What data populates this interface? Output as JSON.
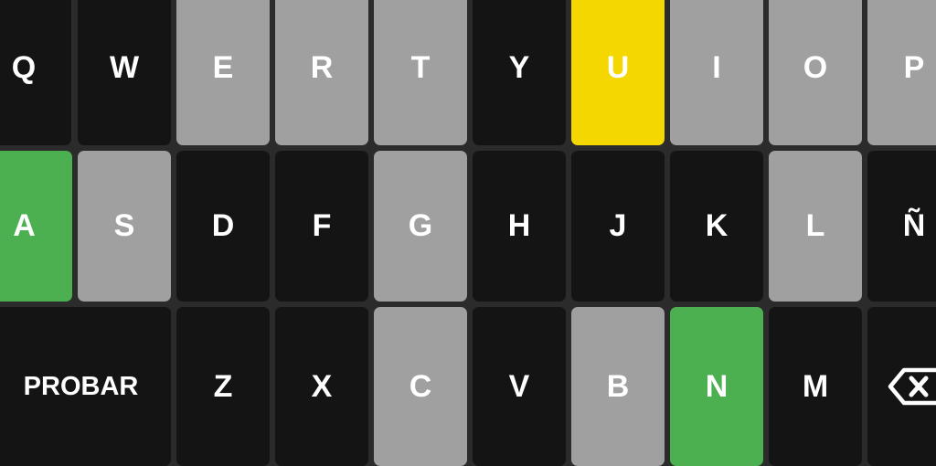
{
  "colors": {
    "background": "#2b2b2b",
    "absent": "#141414",
    "present_elsewhere": "#a0a0a0",
    "present": "#f5d700",
    "correct": "#4caf50",
    "text": "#ffffff"
  },
  "keyboard": {
    "row1": [
      {
        "label": "Q",
        "state": "absent"
      },
      {
        "label": "W",
        "state": "absent"
      },
      {
        "label": "E",
        "state": "gray"
      },
      {
        "label": "R",
        "state": "gray"
      },
      {
        "label": "T",
        "state": "gray"
      },
      {
        "label": "Y",
        "state": "absent"
      },
      {
        "label": "U",
        "state": "present"
      },
      {
        "label": "I",
        "state": "gray"
      },
      {
        "label": "O",
        "state": "gray"
      },
      {
        "label": "P",
        "state": "gray"
      }
    ],
    "row2": [
      {
        "label": "A",
        "state": "correct"
      },
      {
        "label": "S",
        "state": "gray"
      },
      {
        "label": "D",
        "state": "absent"
      },
      {
        "label": "F",
        "state": "absent"
      },
      {
        "label": "G",
        "state": "gray"
      },
      {
        "label": "H",
        "state": "absent"
      },
      {
        "label": "J",
        "state": "absent"
      },
      {
        "label": "K",
        "state": "absent"
      },
      {
        "label": "L",
        "state": "gray"
      },
      {
        "label": "Ñ",
        "state": "absent"
      }
    ],
    "row3": [
      {
        "label": "Z",
        "state": "absent"
      },
      {
        "label": "X",
        "state": "absent"
      },
      {
        "label": "C",
        "state": "gray"
      },
      {
        "label": "V",
        "state": "absent"
      },
      {
        "label": "B",
        "state": "gray"
      },
      {
        "label": "N",
        "state": "correct"
      },
      {
        "label": "M",
        "state": "absent"
      }
    ],
    "enter_label": "PROBAR",
    "backspace_icon": "backspace-icon"
  }
}
